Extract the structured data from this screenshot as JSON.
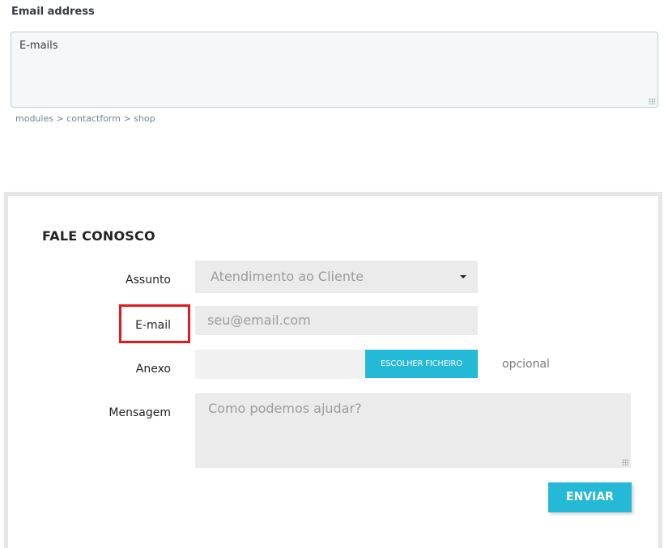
{
  "config": {
    "email_label": "Email address",
    "email_value": "E-mails",
    "helper_text": "modules > contactform > shop"
  },
  "form": {
    "title": "FALE CONOSCO",
    "subject_label": "Assunto",
    "subject_value": "Atendimento ao Cliente",
    "email_label": "E-mail",
    "email_placeholder": "seu@email.com",
    "attachment_label": "Anexo",
    "attachment_button": "ESCOLHER FICHEIRO",
    "attachment_optional": "opcional",
    "message_label": "Mensagem",
    "message_placeholder": "Como podemos ajudar?",
    "submit_label": "ENVIAR"
  },
  "colors": {
    "accent": "#24b9d7",
    "highlight": "#e2191f",
    "field_bg": "#ebebeb"
  },
  "icons": {
    "select_caret": "caret-down-icon",
    "textarea_grip": "resize-grip-icon"
  }
}
